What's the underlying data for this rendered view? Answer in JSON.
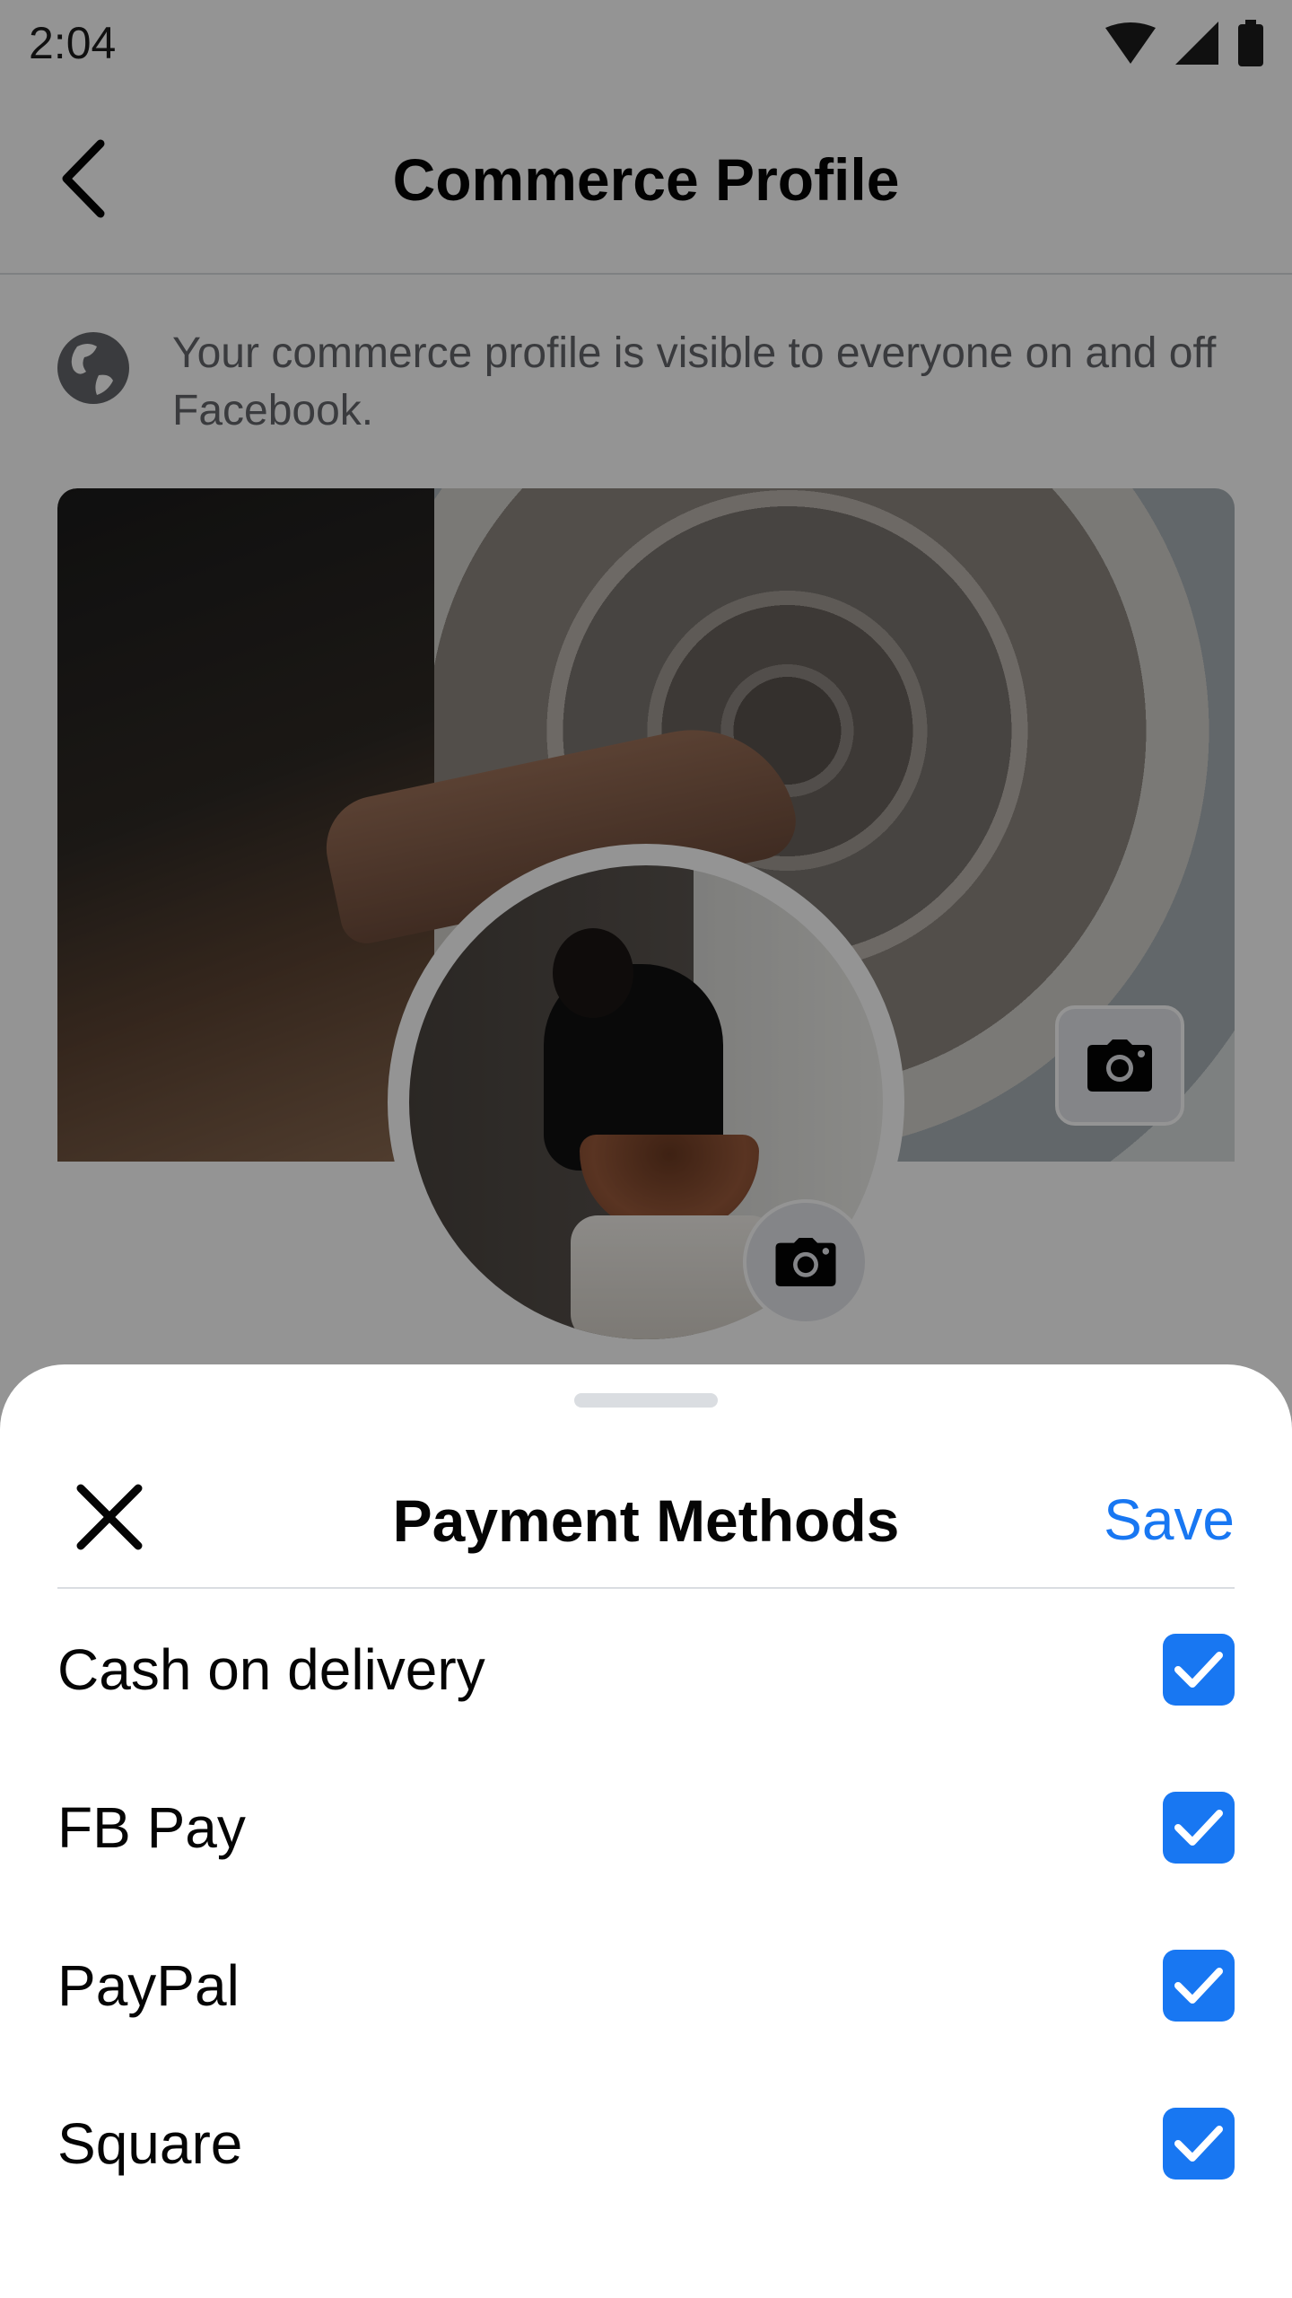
{
  "status_bar": {
    "time": "2:04",
    "icons": [
      "wifi-icon",
      "cellular-signal-icon",
      "battery-icon"
    ]
  },
  "header": {
    "back_icon": "chevron-left-icon",
    "title": "Commerce Profile"
  },
  "notice": {
    "icon": "globe-icon",
    "text": "Your commerce profile is visible to everyone on and off Facebook."
  },
  "cover_photo": {
    "camera_icon": "camera-icon"
  },
  "profile_photo": {
    "camera_icon": "camera-icon"
  },
  "sheet": {
    "close_icon": "close-icon",
    "title": "Payment Methods",
    "save_label": "Save",
    "methods": [
      {
        "label": "Cash on delivery",
        "checked": true
      },
      {
        "label": "FB Pay",
        "checked": true
      },
      {
        "label": "PayPal",
        "checked": true
      },
      {
        "label": "Square",
        "checked": true
      }
    ]
  },
  "colors": {
    "accent": "#1877f2",
    "divider": "#dadde1",
    "secondary_text": "#65676b"
  }
}
